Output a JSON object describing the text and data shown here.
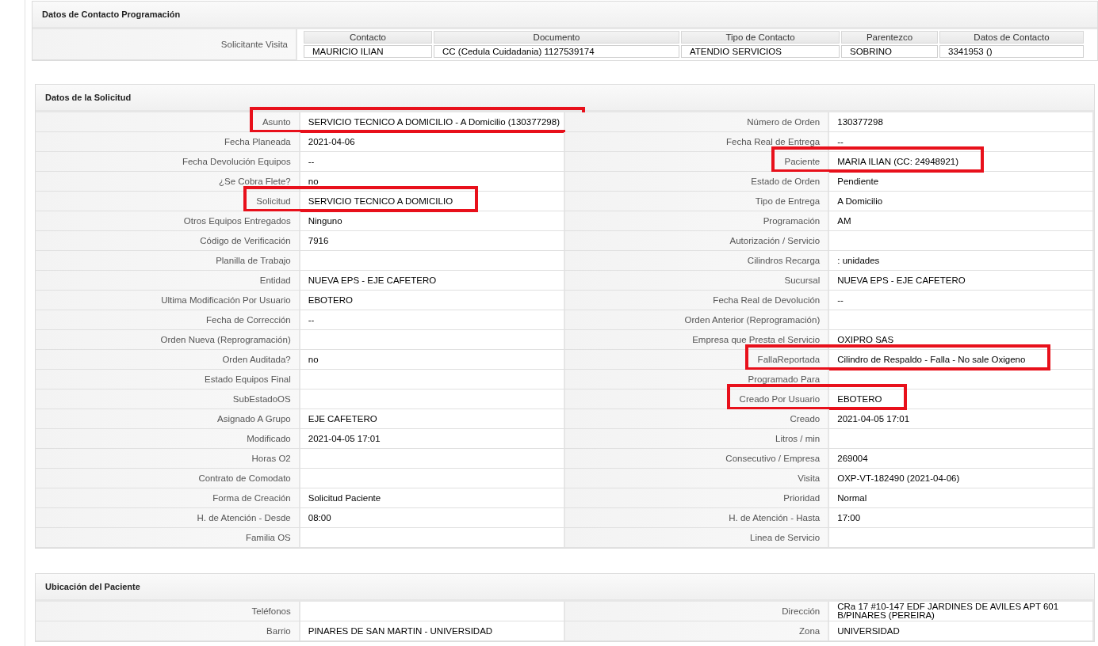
{
  "contacto": {
    "title": "Datos de Contacto Programación",
    "label": "Solicitante Visita",
    "columns": [
      "Contacto",
      "Documento",
      "Tipo de Contacto",
      "Parentezco",
      "Datos de Contacto"
    ],
    "row": [
      "MAURICIO ILIAN",
      "CC (Cedula Cuidadania) 1127539174",
      "ATENDIO SERVICIOS",
      "SOBRINO",
      "3341953 ()"
    ]
  },
  "solicitud": {
    "title": "Datos de la Solicitud",
    "rows": [
      {
        "left": {
          "label": "Asunto",
          "value": "SERVICIO TECNICO A DOMICILIO - A Domicilio (130377298)",
          "highlighted": true
        },
        "right": {
          "label": "Número de Orden",
          "value": "130377298",
          "highlighted": false
        }
      },
      {
        "left": {
          "label": "Fecha Planeada",
          "value": "2021-04-06",
          "highlighted": false
        },
        "right": {
          "label": "Fecha Real de Entrega",
          "value": "--",
          "highlighted": false
        }
      },
      {
        "left": {
          "label": "Fecha Devolución Equipos",
          "value": "--",
          "highlighted": false
        },
        "right": {
          "label": "Paciente",
          "value": "MARIA ILIAN (CC: 24948921)",
          "highlighted": true
        }
      },
      {
        "left": {
          "label": "¿Se Cobra Flete?",
          "value": "no",
          "highlighted": false
        },
        "right": {
          "label": "Estado de Orden",
          "value": "Pendiente",
          "highlighted": false
        }
      },
      {
        "left": {
          "label": "Solicitud",
          "value": "SERVICIO TECNICO A DOMICILIO",
          "highlighted": true
        },
        "right": {
          "label": "Tipo de Entrega",
          "value": "A Domicilio",
          "highlighted": false
        }
      },
      {
        "left": {
          "label": "Otros Equipos Entregados",
          "value": "Ninguno",
          "highlighted": false
        },
        "right": {
          "label": "Programación",
          "value": "AM",
          "highlighted": false
        }
      },
      {
        "left": {
          "label": "Código de Verificación",
          "value": "7916",
          "highlighted": false
        },
        "right": {
          "label": "Autorización / Servicio",
          "highlighted": false
        }
      },
      {
        "left": {
          "label": "Planilla de Trabajo",
          "highlighted": false
        },
        "right": {
          "label": "Cilindros Recarga",
          "value": ": unidades",
          "highlighted": false
        }
      },
      {
        "left": {
          "label": "Entidad",
          "value": "NUEVA EPS - EJE CAFETERO",
          "highlighted": false
        },
        "right": {
          "label": "Sucursal",
          "value": "NUEVA EPS - EJE CAFETERO",
          "highlighted": false
        }
      },
      {
        "left": {
          "label": "Ultima Modificación Por Usuario",
          "value": "EBOTERO",
          "highlighted": false
        },
        "right": {
          "label": "Fecha Real de Devolución",
          "value": "--",
          "highlighted": false
        }
      },
      {
        "left": {
          "label": "Fecha de Corrección",
          "value": "--",
          "highlighted": false
        },
        "right": {
          "label": "Orden Anterior (Reprogramación)",
          "highlighted": false
        }
      },
      {
        "left": {
          "label": "Orden Nueva (Reprogramación)",
          "highlighted": false
        },
        "right": {
          "label": "Empresa que Presta el Servicio",
          "value": "OXIPRO SAS",
          "highlighted": false
        }
      },
      {
        "left": {
          "label": "Orden Auditada?",
          "value": "no",
          "highlighted": false
        },
        "right": {
          "label": "FallaReportada",
          "value": "Cilindro de Respaldo - Falla - No sale Oxigeno",
          "highlighted": true
        }
      },
      {
        "left": {
          "label": "Estado Equipos Final",
          "highlighted": false
        },
        "right": {
          "label": "Programado Para",
          "highlighted": false
        }
      },
      {
        "left": {
          "label": "SubEstadoOS",
          "highlighted": false
        },
        "right": {
          "label": "Creado Por Usuario",
          "value": "EBOTERO",
          "highlighted": true
        }
      },
      {
        "left": {
          "label": "Asignado A Grupo",
          "value": "EJE CAFETERO",
          "highlighted": false
        },
        "right": {
          "label": "Creado",
          "value": "2021-04-05 17:01",
          "highlighted": false
        }
      },
      {
        "left": {
          "label": "Modificado",
          "value": "2021-04-05 17:01",
          "highlighted": false
        },
        "right": {
          "label": "Litros / min",
          "highlighted": false
        }
      },
      {
        "left": {
          "label": "Horas O2",
          "highlighted": false
        },
        "right": {
          "label": "Consecutivo / Empresa",
          "value": "269004",
          "highlighted": false
        }
      },
      {
        "left": {
          "label": "Contrato de Comodato",
          "highlighted": false
        },
        "right": {
          "label": "Visita",
          "value": "OXP-VT-182490 (2021-04-06)",
          "highlighted": false
        }
      },
      {
        "left": {
          "label": "Forma de Creación",
          "value": "Solicitud Paciente",
          "highlighted": false
        },
        "right": {
          "label": "Prioridad",
          "value": "Normal",
          "highlighted": false
        }
      },
      {
        "left": {
          "label": "H. de Atención - Desde",
          "value": "08:00",
          "highlighted": false
        },
        "right": {
          "label": "H. de Atención - Hasta",
          "value": "17:00",
          "highlighted": false
        }
      },
      {
        "left": {
          "label": "Familia OS",
          "highlighted": false
        },
        "right": {
          "label": "Linea de Servicio",
          "highlighted": false
        }
      }
    ]
  },
  "ubicacion": {
    "title": "Ubicación del Paciente",
    "rows": [
      {
        "left": {
          "label": "Teléfonos",
          "highlighted": false
        },
        "right": {
          "label": "Dirección",
          "value": "CRa 17 #10-147 EDF JARDINES DE AVILES APT 601 B/PINARES (PEREIRA)",
          "highlighted": false
        }
      },
      {
        "left": {
          "label": "Barrio",
          "value": "PINARES DE SAN MARTIN - UNIVERSIDAD",
          "highlighted": false
        },
        "right": {
          "label": "Zona",
          "value": "UNIVERSIDAD",
          "highlighted": false
        }
      }
    ]
  }
}
